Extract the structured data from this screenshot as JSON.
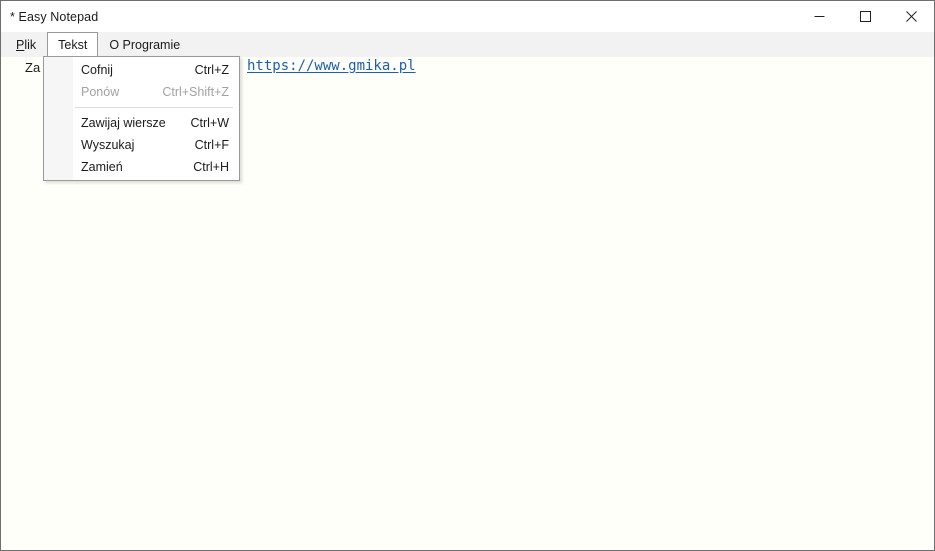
{
  "window": {
    "title": "* Easy Notepad",
    "caption_buttons": [
      {
        "name": "minimize",
        "label": "—"
      },
      {
        "name": "maximize",
        "label": "□"
      },
      {
        "name": "close",
        "label": "✕"
      }
    ]
  },
  "menubar": {
    "items": [
      {
        "label": "Plik",
        "mnemonic": "P",
        "rest": "lik",
        "state": "normal"
      },
      {
        "label": "Tekst",
        "state": "open"
      },
      {
        "label": "O Programie",
        "state": "normal"
      }
    ]
  },
  "dropdown": {
    "owner": "Tekst",
    "items": [
      {
        "label": "Cofnij",
        "accel": "Ctrl+Z",
        "enabled": true
      },
      {
        "label": "Ponów",
        "accel": "Ctrl+Shift+Z",
        "enabled": false
      },
      {
        "separator": true
      },
      {
        "label": "Zawijaj wiersze",
        "accel": "Ctrl+W",
        "enabled": true
      },
      {
        "label": "Wyszukaj",
        "accel": "Ctrl+F",
        "enabled": true
      },
      {
        "label": "Zamień",
        "accel": "Ctrl+H",
        "enabled": true
      }
    ]
  },
  "editor": {
    "visible_prefix": "Za",
    "link_text": "https://www.gmika.pl",
    "link_color": "#1a5fb4"
  },
  "colors": {
    "titlebar_bg": "#ffffff",
    "menubar_bg": "#f2f2f2",
    "editor_bg": "#fffffa",
    "window_border": "#6e6e6e",
    "menu_border": "#9a9a9a",
    "text": "#1b1b1b",
    "disabled_text": "#a3a3a3"
  }
}
